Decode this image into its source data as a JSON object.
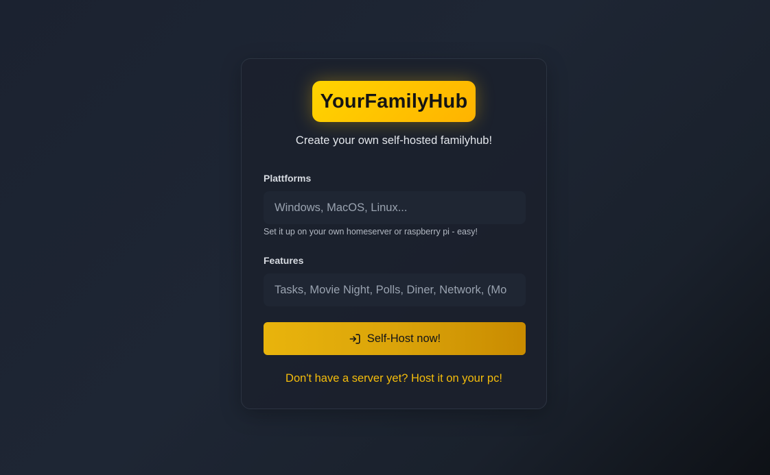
{
  "brand": {
    "name": "YourFamilyHub",
    "tagline": "Create your own self-hosted familyhub!"
  },
  "form": {
    "platforms": {
      "label": "Plattforms",
      "value": "Windows, MacOS, Linux...",
      "hint": "Set it up on your own homeserver or raspberry pi - easy!"
    },
    "features": {
      "label": "Features",
      "value": "Tasks, Movie Night, Polls, Diner, Network, (Mo"
    },
    "submit": {
      "label": "Self-Host now!",
      "icon": "login-icon"
    },
    "secondary_link": "Don't have a server yet? Host it on your pc!"
  },
  "colors": {
    "accent": "#ffc400",
    "accent_dark": "#c98b00",
    "link": "#f5bd0b",
    "card_bg": "#1b212c",
    "page_bg": "#1e2634"
  }
}
